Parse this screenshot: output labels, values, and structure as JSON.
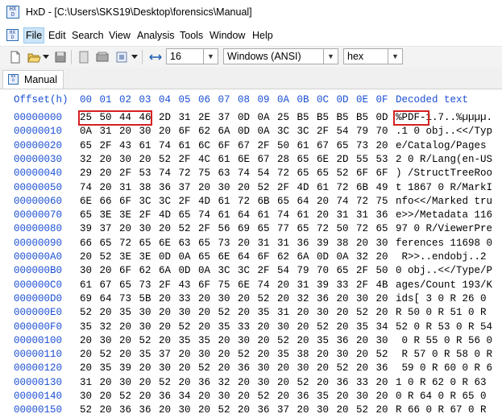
{
  "window": {
    "app_name": "HxD",
    "title": "HxD - [C:\\Users\\SKS19\\Desktop\\forensics\\Manual]",
    "icon": "hxd-app-icon"
  },
  "menu": {
    "items": [
      "File",
      "Edit",
      "Search",
      "View",
      "Analysis",
      "Tools",
      "Window",
      "Help"
    ],
    "active": "File"
  },
  "toolbar": {
    "bytes_per_row": "16",
    "charset": "Windows (ANSI)",
    "display_mode": "hex"
  },
  "tabs": [
    {
      "label": "Manual"
    }
  ],
  "editor": {
    "offset_header": "Offset(h)",
    "column_headers": [
      "00",
      "01",
      "02",
      "03",
      "04",
      "05",
      "06",
      "07",
      "08",
      "09",
      "0A",
      "0B",
      "0C",
      "0D",
      "0E",
      "0F"
    ],
    "decoded_header": "Decoded text",
    "rows": [
      {
        "offset": "00000000",
        "bytes": [
          "25",
          "50",
          "44",
          "46",
          "2D",
          "31",
          "2E",
          "37",
          "0D",
          "0A",
          "25",
          "B5",
          "B5",
          "B5",
          "B5",
          "0D"
        ],
        "decoded": "%PDF-1.7..%µµµµ."
      },
      {
        "offset": "00000010",
        "bytes": [
          "0A",
          "31",
          "20",
          "30",
          "20",
          "6F",
          "62",
          "6A",
          "0D",
          "0A",
          "3C",
          "3C",
          "2F",
          "54",
          "79",
          "70"
        ],
        "decoded": ".1 0 obj..<</Typ"
      },
      {
        "offset": "00000020",
        "bytes": [
          "65",
          "2F",
          "43",
          "61",
          "74",
          "61",
          "6C",
          "6F",
          "67",
          "2F",
          "50",
          "61",
          "67",
          "65",
          "73",
          "20"
        ],
        "decoded": "e/Catalog/Pages "
      },
      {
        "offset": "00000030",
        "bytes": [
          "32",
          "20",
          "30",
          "20",
          "52",
          "2F",
          "4C",
          "61",
          "6E",
          "67",
          "28",
          "65",
          "6E",
          "2D",
          "55",
          "53"
        ],
        "decoded": "2 0 R/Lang(en-US"
      },
      {
        "offset": "00000040",
        "bytes": [
          "29",
          "20",
          "2F",
          "53",
          "74",
          "72",
          "75",
          "63",
          "74",
          "54",
          "72",
          "65",
          "65",
          "52",
          "6F",
          "6F"
        ],
        "decoded": ") /StructTreeRoo"
      },
      {
        "offset": "00000050",
        "bytes": [
          "74",
          "20",
          "31",
          "38",
          "36",
          "37",
          "20",
          "30",
          "20",
          "52",
          "2F",
          "4D",
          "61",
          "72",
          "6B",
          "49"
        ],
        "decoded": "t 1867 0 R/MarkI"
      },
      {
        "offset": "00000060",
        "bytes": [
          "6E",
          "66",
          "6F",
          "3C",
          "3C",
          "2F",
          "4D",
          "61",
          "72",
          "6B",
          "65",
          "64",
          "20",
          "74",
          "72",
          "75"
        ],
        "decoded": "nfo<</Marked tru"
      },
      {
        "offset": "00000070",
        "bytes": [
          "65",
          "3E",
          "3E",
          "2F",
          "4D",
          "65",
          "74",
          "61",
          "64",
          "61",
          "74",
          "61",
          "20",
          "31",
          "31",
          "36"
        ],
        "decoded": "e>>/Metadata 116"
      },
      {
        "offset": "00000080",
        "bytes": [
          "39",
          "37",
          "20",
          "30",
          "20",
          "52",
          "2F",
          "56",
          "69",
          "65",
          "77",
          "65",
          "72",
          "50",
          "72",
          "65"
        ],
        "decoded": "97 0 R/ViewerPre"
      },
      {
        "offset": "00000090",
        "bytes": [
          "66",
          "65",
          "72",
          "65",
          "6E",
          "63",
          "65",
          "73",
          "20",
          "31",
          "31",
          "36",
          "39",
          "38",
          "20",
          "30"
        ],
        "decoded": "ferences 11698 0"
      },
      {
        "offset": "000000A0",
        "bytes": [
          "20",
          "52",
          "3E",
          "3E",
          "0D",
          "0A",
          "65",
          "6E",
          "64",
          "6F",
          "62",
          "6A",
          "0D",
          "0A",
          "32",
          "20"
        ],
        "decoded": " R>>..endobj..2 "
      },
      {
        "offset": "000000B0",
        "bytes": [
          "30",
          "20",
          "6F",
          "62",
          "6A",
          "0D",
          "0A",
          "3C",
          "3C",
          "2F",
          "54",
          "79",
          "70",
          "65",
          "2F",
          "50"
        ],
        "decoded": "0 obj..<</Type/P"
      },
      {
        "offset": "000000C0",
        "bytes": [
          "61",
          "67",
          "65",
          "73",
          "2F",
          "43",
          "6F",
          "75",
          "6E",
          "74",
          "20",
          "31",
          "39",
          "33",
          "2F",
          "4B"
        ],
        "decoded": "ages/Count 193/K"
      },
      {
        "offset": "000000D0",
        "bytes": [
          "69",
          "64",
          "73",
          "5B",
          "20",
          "33",
          "20",
          "30",
          "20",
          "52",
          "20",
          "32",
          "36",
          "20",
          "30",
          "20"
        ],
        "decoded": "ids[ 3 0 R 26 0 "
      },
      {
        "offset": "000000E0",
        "bytes": [
          "52",
          "20",
          "35",
          "30",
          "20",
          "30",
          "20",
          "52",
          "20",
          "35",
          "31",
          "20",
          "30",
          "20",
          "52",
          "20"
        ],
        "decoded": "R 50 0 R 51 0 R "
      },
      {
        "offset": "000000F0",
        "bytes": [
          "35",
          "32",
          "20",
          "30",
          "20",
          "52",
          "20",
          "35",
          "33",
          "20",
          "30",
          "20",
          "52",
          "20",
          "35",
          "34"
        ],
        "decoded": "52 0 R 53 0 R 54"
      },
      {
        "offset": "00000100",
        "bytes": [
          "20",
          "30",
          "20",
          "52",
          "20",
          "35",
          "35",
          "20",
          "30",
          "20",
          "52",
          "20",
          "35",
          "36",
          "20",
          "30"
        ],
        "decoded": " 0 R 55 0 R 56 0"
      },
      {
        "offset": "00000110",
        "bytes": [
          "20",
          "52",
          "20",
          "35",
          "37",
          "20",
          "30",
          "20",
          "52",
          "20",
          "35",
          "38",
          "20",
          "30",
          "20",
          "52"
        ],
        "decoded": " R 57 0 R 58 0 R"
      },
      {
        "offset": "00000120",
        "bytes": [
          "20",
          "35",
          "39",
          "20",
          "30",
          "20",
          "52",
          "20",
          "36",
          "30",
          "20",
          "30",
          "20",
          "52",
          "20",
          "36"
        ],
        "decoded": " 59 0 R 60 0 R 6"
      },
      {
        "offset": "00000130",
        "bytes": [
          "31",
          "20",
          "30",
          "20",
          "52",
          "20",
          "36",
          "32",
          "20",
          "30",
          "20",
          "52",
          "20",
          "36",
          "33",
          "20"
        ],
        "decoded": "1 0 R 62 0 R 63 "
      },
      {
        "offset": "00000140",
        "bytes": [
          "30",
          "20",
          "52",
          "20",
          "36",
          "34",
          "20",
          "30",
          "20",
          "52",
          "20",
          "36",
          "35",
          "20",
          "30",
          "20"
        ],
        "decoded": "0 R 64 0 R 65 0 "
      },
      {
        "offset": "00000150",
        "bytes": [
          "52",
          "20",
          "36",
          "36",
          "20",
          "30",
          "20",
          "52",
          "20",
          "36",
          "37",
          "20",
          "30",
          "20",
          "52",
          "20"
        ],
        "decoded": "R 66 0 R 67 0 R "
      }
    ]
  }
}
